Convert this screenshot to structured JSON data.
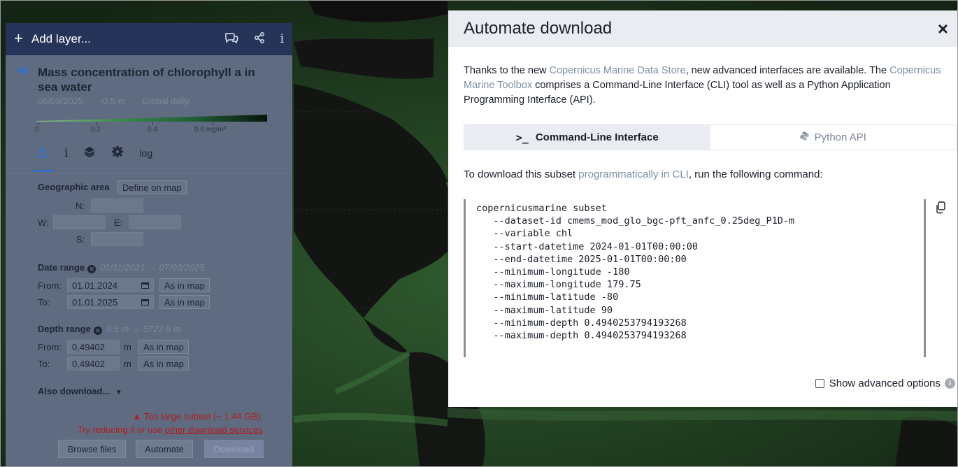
{
  "left_panel": {
    "header": {
      "plus_icon": "+",
      "title": "Add layer...",
      "comments_icon": "comments-icon",
      "share_icon": "share-icon",
      "info_icon": "i"
    },
    "layer": {
      "title": "Mass concentration of chlorophyll a in sea water",
      "date": "06/03/2025",
      "depth": "-0.5 m",
      "frequency": "Global daily",
      "sep": "·",
      "colorbar_ticks": [
        "0",
        "0.2",
        "0.4",
        "0.6 mg/m³"
      ]
    },
    "tools": {
      "download_icon": "download-icon",
      "info_label": "i",
      "layers_icon": "layers-icon",
      "settings_icon": "gear-icon",
      "log_label": "log"
    },
    "geographic": {
      "label": "Geographic area",
      "define_button": "Define on map",
      "n_label": "N:",
      "w_label": "W:",
      "e_label": "E:",
      "s_label": "S:"
    },
    "date_range": {
      "label": "Date range",
      "range_hint": "01/11/2021 → 07/03/2025",
      "from_label": "From:",
      "from_value": "01.01.2024",
      "to_label": "To:",
      "to_value": "01.01.2025",
      "as_in_map": "As in map"
    },
    "depth_range": {
      "label": "Depth range",
      "range_hint": "0.5 m → 5727.9 m",
      "from_label": "From:",
      "from_value": "0,49402",
      "to_label": "To:",
      "to_value": "0,49402",
      "unit": "m",
      "as_in_map": "As in map"
    },
    "also_download": "Also download...",
    "warning_line1": "Too large subset (~ 1.44 GB):",
    "warning_line2_prefix": "Try reducing it or use ",
    "warning_link": "other download services",
    "buttons": {
      "browse": "Browse files",
      "automate": "Automate",
      "download": "Download"
    }
  },
  "modal": {
    "title": "Automate download",
    "close_icon": "×",
    "intro_1": "Thanks to the new ",
    "intro_link1": "Copernicus Marine Data Store",
    "intro_2": ", new advanced interfaces are available. The ",
    "intro_link2": "Copernicus Marine Toolbox",
    "intro_3": " comprises a Command-Line Interface (CLI) tool as well as a Python Application Programming Interface (API).",
    "tabs": [
      {
        "icon": ">_",
        "label": "Command-Line Interface"
      },
      {
        "icon": "python-icon",
        "label": "Python API"
      }
    ],
    "cli_note_1": "To download this subset ",
    "cli_note_link": "programmatically in CLI",
    "cli_note_2": ", run the following command:",
    "code_lines": [
      "copernicusmarine subset",
      "   --dataset-id cmems_mod_glo_bgc-pft_anfc_0.25deg_P1D-m",
      "   --variable chl",
      "   --start-datetime 2024-01-01T00:00:00",
      "   --end-datetime 2025-01-01T00:00:00",
      "   --minimum-longitude -180",
      "   --maximum-longitude 179.75",
      "   --minimum-latitude -80",
      "   --maximum-latitude 90",
      "   --minimum-depth 0.4940253794193268",
      "   --maximum-depth 0.4940253794193268"
    ],
    "advanced_label": "Show advanced options",
    "info_icon": "i"
  }
}
